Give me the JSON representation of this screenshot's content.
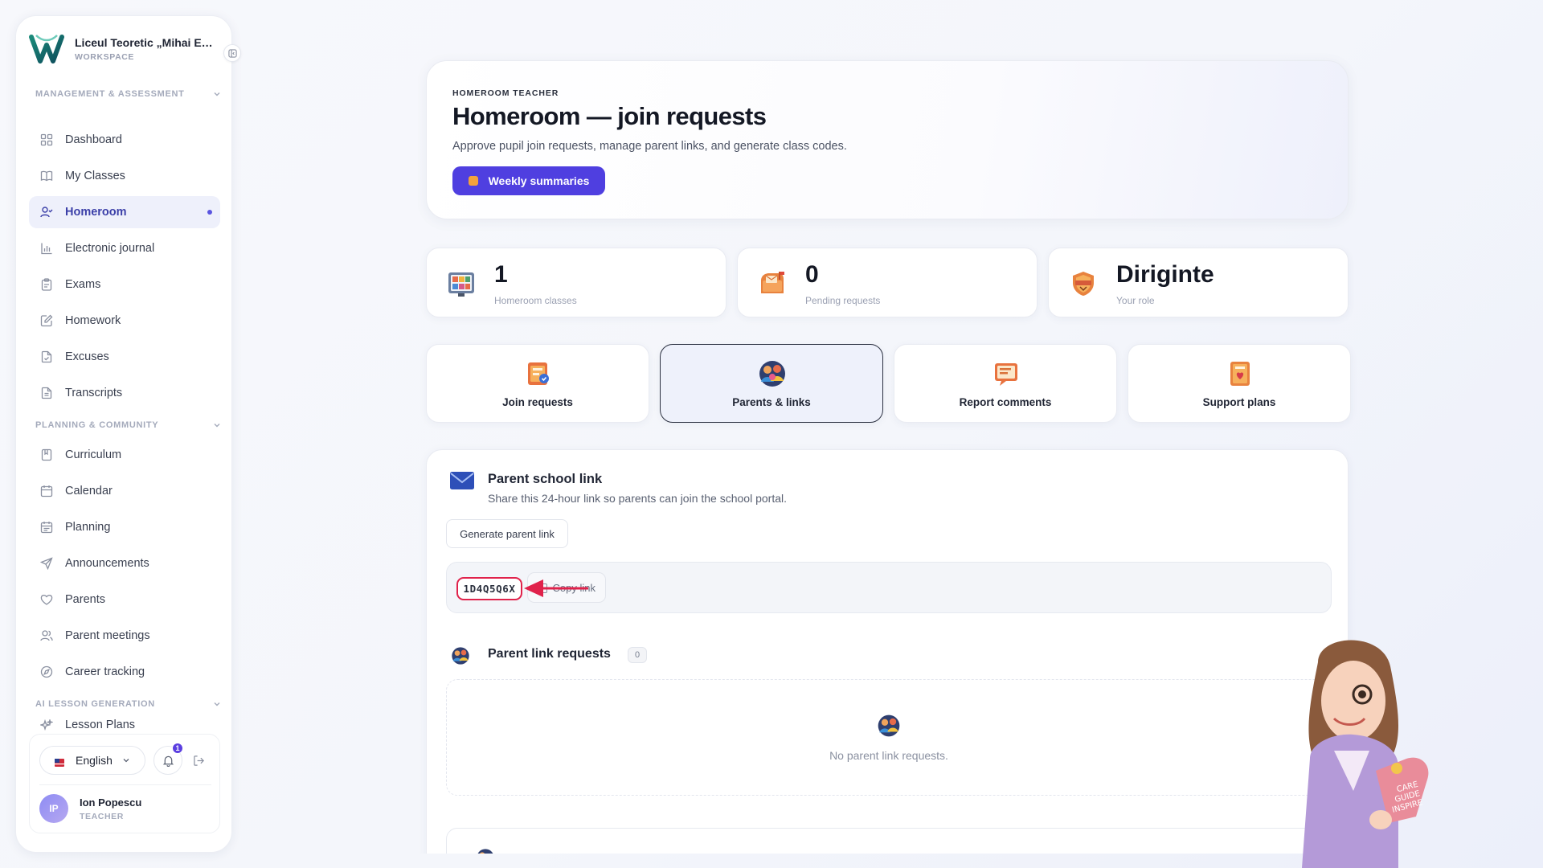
{
  "workspace": {
    "name": "Liceul Teoretic „Mihai Eminescu”",
    "subtitle": "WORKSPACE"
  },
  "sidebar": {
    "sections": [
      {
        "label": "MANAGEMENT & ASSESSMENT",
        "items": [
          {
            "label": "Dashboard",
            "icon": "grid-icon"
          },
          {
            "label": "My Classes",
            "icon": "book-icon"
          },
          {
            "label": "Homeroom",
            "icon": "user-check-icon",
            "active": true
          },
          {
            "label": "Electronic journal",
            "icon": "bar-chart-icon"
          },
          {
            "label": "Exams",
            "icon": "clipboard-icon"
          },
          {
            "label": "Homework",
            "icon": "edit-icon"
          },
          {
            "label": "Excuses",
            "icon": "file-check-icon"
          },
          {
            "label": "Transcripts",
            "icon": "file-text-icon"
          }
        ]
      },
      {
        "label": "PLANNING & COMMUNITY",
        "items": [
          {
            "label": "Curriculum",
            "icon": "bookmark-book-icon"
          },
          {
            "label": "Calendar",
            "icon": "calendar-icon"
          },
          {
            "label": "Planning",
            "icon": "calendar-list-icon"
          },
          {
            "label": "Announcements",
            "icon": "send-icon"
          },
          {
            "label": "Parents",
            "icon": "heart-icon"
          },
          {
            "label": "Parent meetings",
            "icon": "users-icon"
          },
          {
            "label": "Career tracking",
            "icon": "compass-icon"
          }
        ]
      },
      {
        "label": "AI LESSON GENERATION",
        "items": [
          {
            "label": "Lesson Plans",
            "icon": "sparkles-icon"
          }
        ]
      }
    ],
    "language": "English",
    "notification_count": "1",
    "user": {
      "initials": "IP",
      "name": "Ion Popescu",
      "role": "TEACHER"
    }
  },
  "hero": {
    "eyebrow": "HOMEROOM TEACHER",
    "title": "Homeroom — join requests",
    "subtitle": "Approve pupil join requests, manage parent links, and generate class codes.",
    "button_label": "Weekly summaries"
  },
  "stats": [
    {
      "value": "1",
      "label": "Homeroom classes",
      "icon": "classroom-board-icon"
    },
    {
      "value": "0",
      "label": "Pending requests",
      "icon": "mailbox-icon"
    },
    {
      "value": "Diriginte",
      "label": "Your role",
      "icon": "shield-badge-icon"
    }
  ],
  "tabs": [
    {
      "label": "Join requests",
      "icon": "request-form-icon",
      "active": false
    },
    {
      "label": "Parents & links",
      "icon": "family-icon",
      "active": true
    },
    {
      "label": "Report comments",
      "icon": "comment-board-icon",
      "active": false
    },
    {
      "label": "Support plans",
      "icon": "support-notebook-icon",
      "active": false
    }
  ],
  "parent_link": {
    "title": "Parent school link",
    "subtitle": "Share this 24-hour link so parents can join the school portal.",
    "generate_label": "Generate parent link",
    "code": "1D4Q5Q6X",
    "copy_label": "Copy link"
  },
  "parent_requests": {
    "title": "Parent link requests",
    "count": "0",
    "empty_text": "No parent link requests."
  },
  "colors": {
    "accent": "#4f3fe0",
    "highlight": "#e0224b",
    "active_nav_bg": "#eef0fb"
  }
}
